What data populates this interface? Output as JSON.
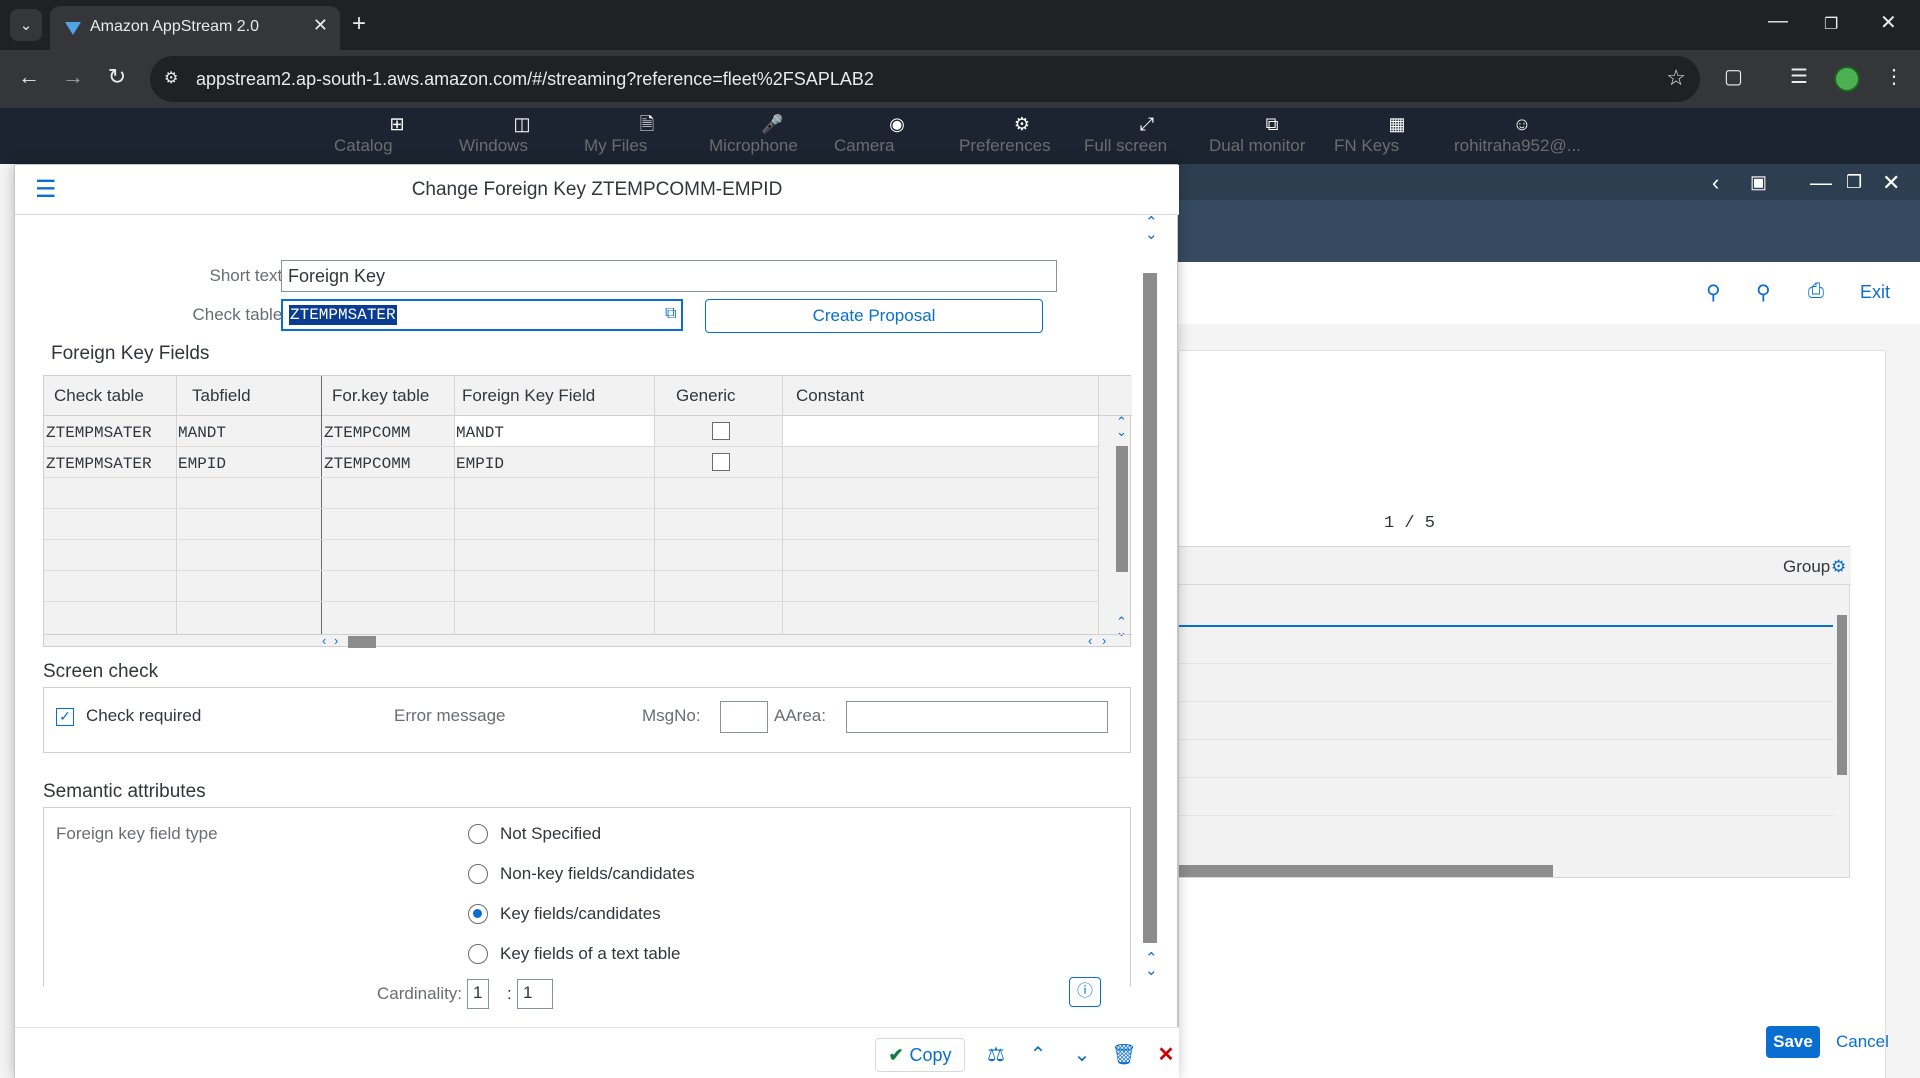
{
  "browser": {
    "tab_title": "Amazon AppStream 2.0",
    "url": "appstream2.ap-south-1.aws.amazon.com/#/streaming?reference=fleet%2FSAPLAB2"
  },
  "appstream_toolbar": {
    "items": [
      {
        "label": "Catalog",
        "icon": "catalog-icon"
      },
      {
        "label": "Windows",
        "icon": "windows-icon"
      },
      {
        "label": "My Files",
        "icon": "files-icon"
      },
      {
        "label": "Microphone",
        "icon": "microphone-icon"
      },
      {
        "label": "Camera",
        "icon": "camera-icon"
      },
      {
        "label": "Preferences",
        "icon": "gear-icon"
      },
      {
        "label": "Full screen",
        "icon": "fullscreen-icon"
      },
      {
        "label": "Dual monitor",
        "icon": "dual-monitor-icon"
      },
      {
        "label": "FN Keys",
        "icon": "keyboard-icon"
      },
      {
        "label": "rohitraha952@...",
        "icon": "user-icon"
      }
    ]
  },
  "background_window": {
    "exit_label": "Exit",
    "pager": "1  /  5",
    "table_header": "Group",
    "save_label": "Save",
    "cancel_label": "Cancel"
  },
  "dialog": {
    "title": "Change Foreign Key ZTEMPCOMM-EMPID",
    "short_text_label": "Short text:",
    "short_text_value": "Foreign Key",
    "check_table_label": "Check table:",
    "check_table_value": "ZTEMPMSATER",
    "create_proposal_label": "Create Proposal",
    "fk_fields_title": "Foreign Key Fields",
    "grid": {
      "columns": [
        "Check table",
        "Tabfield",
        "For.key table",
        "Foreign Key Field",
        "Generic",
        "Constant"
      ],
      "rows": [
        {
          "check_table": "ZTEMPMSATER",
          "tabfield": "MANDT",
          "forkey_table": "ZTEMPCOMM",
          "fk_field": "MANDT",
          "generic": false,
          "constant": ""
        },
        {
          "check_table": "ZTEMPMSATER",
          "tabfield": "EMPID",
          "forkey_table": "ZTEMPCOMM",
          "fk_field": "EMPID",
          "generic": false,
          "constant": ""
        }
      ]
    },
    "screen_check": {
      "title": "Screen check",
      "check_required_label": "Check required",
      "check_required": true,
      "error_message_label": "Error message",
      "msgno_label": "MsgNo:",
      "msgno_value": "",
      "aarea_label": "AArea:",
      "aarea_value": ""
    },
    "semantic": {
      "title": "Semantic attributes",
      "field_type_label": "Foreign key field type",
      "options": [
        {
          "label": "Not Specified",
          "selected": false
        },
        {
          "label": "Non-key fields/candidates",
          "selected": false
        },
        {
          "label": "Key fields/candidates",
          "selected": true
        },
        {
          "label": "Key fields of a text table",
          "selected": false
        }
      ],
      "cardinality_label": "Cardinality:",
      "cardinality_left": "1",
      "cardinality_sep": ":",
      "cardinality_right": "1"
    },
    "footer": {
      "copy_label": "Copy"
    }
  }
}
